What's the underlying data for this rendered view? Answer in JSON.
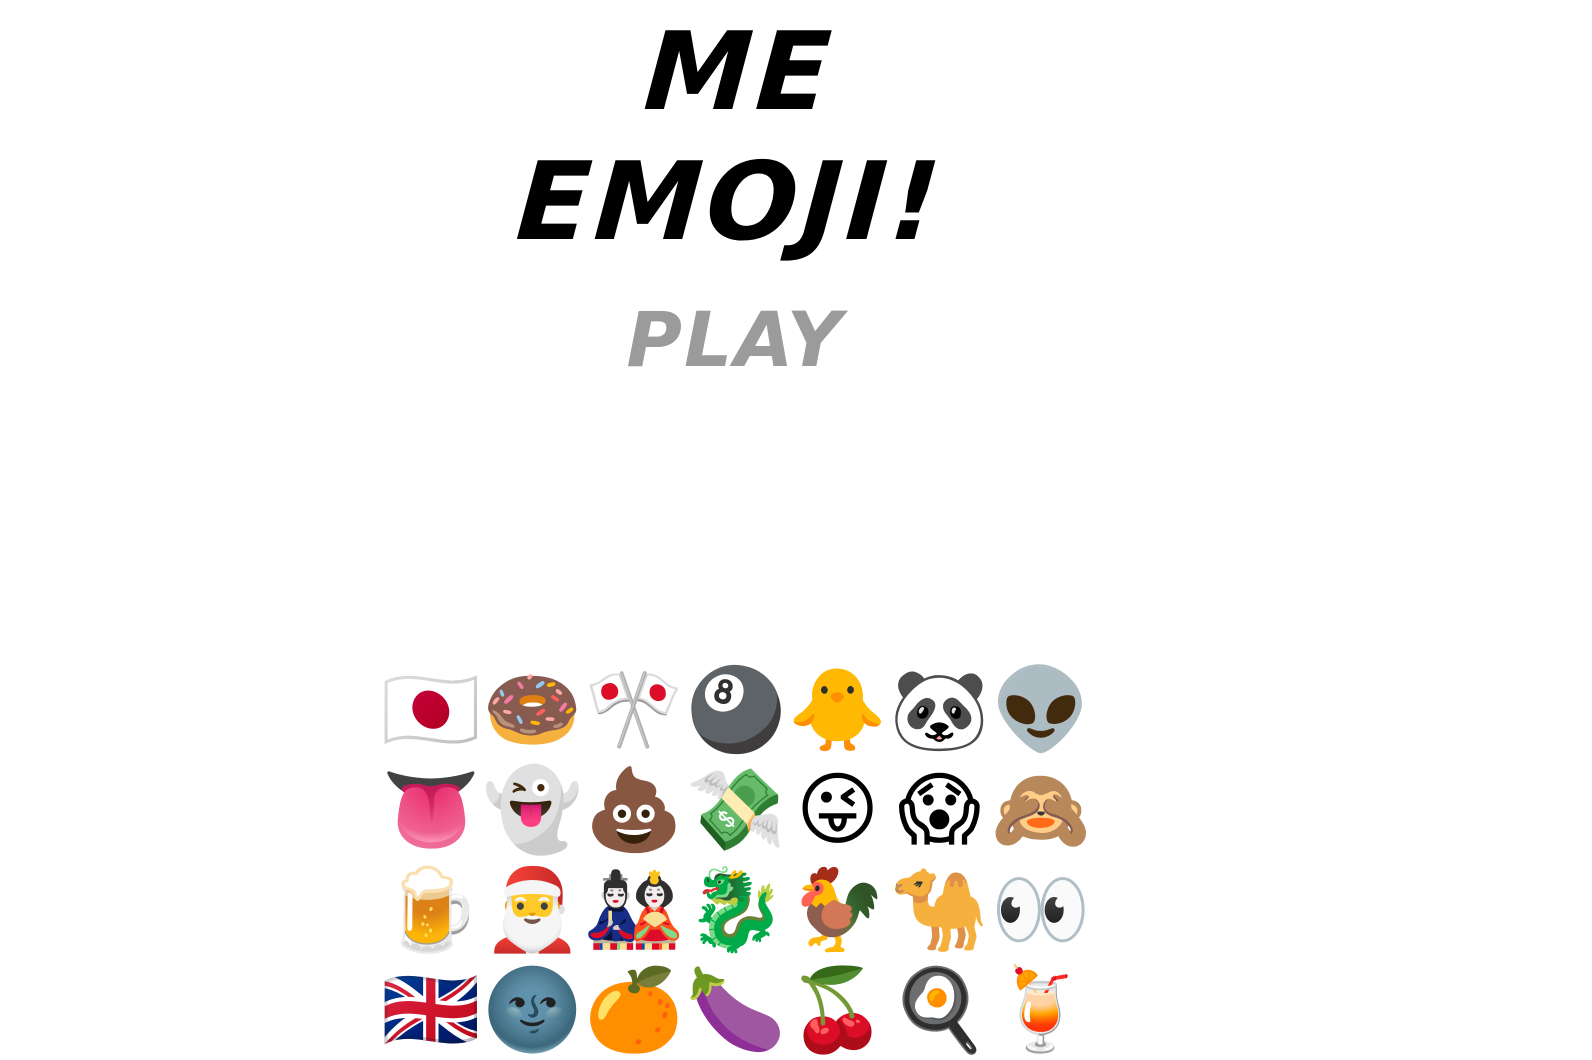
{
  "title": "ME EMOJI!",
  "play_label": "PLAY",
  "emoji_grid": [
    {
      "name": "japan-flag",
      "char": "🇯🇵"
    },
    {
      "name": "doughnut",
      "char": "🍩"
    },
    {
      "name": "crossed-flags",
      "char": "🎌"
    },
    {
      "name": "billiards-8-ball",
      "char": "🎱"
    },
    {
      "name": "baby-chick",
      "char": "🐥"
    },
    {
      "name": "panda-face",
      "char": "🐼"
    },
    {
      "name": "alien",
      "char": "👽"
    },
    {
      "name": "tongue",
      "char": "👅"
    },
    {
      "name": "ghost",
      "char": "👻"
    },
    {
      "name": "pile-of-poo",
      "char": "💩"
    },
    {
      "name": "money-with-wings",
      "char": "💸"
    },
    {
      "name": "winking-face-with-tongue",
      "char": "😜"
    },
    {
      "name": "face-screaming-in-fear",
      "char": "😱"
    },
    {
      "name": "see-no-evil-monkey",
      "char": "🙈"
    },
    {
      "name": "beer-mug",
      "char": "🍺"
    },
    {
      "name": "santa-claus",
      "char": "🎅"
    },
    {
      "name": "japanese-dolls",
      "char": "🎎"
    },
    {
      "name": "dragon",
      "char": "🐉"
    },
    {
      "name": "rooster",
      "char": "🐓"
    },
    {
      "name": "camel",
      "char": "🐪"
    },
    {
      "name": "eyes",
      "char": "👀"
    },
    {
      "name": "uk-flag",
      "char": "🇬🇧"
    },
    {
      "name": "new-moon-face",
      "char": "🌚"
    },
    {
      "name": "orange-circle",
      "char": "🍊"
    },
    {
      "name": "eggplant",
      "char": "🍆"
    },
    {
      "name": "cherries",
      "char": "🍒"
    },
    {
      "name": "cooking-egg",
      "char": "🍳"
    },
    {
      "name": "tropical-drink",
      "char": "🍹"
    }
  ]
}
